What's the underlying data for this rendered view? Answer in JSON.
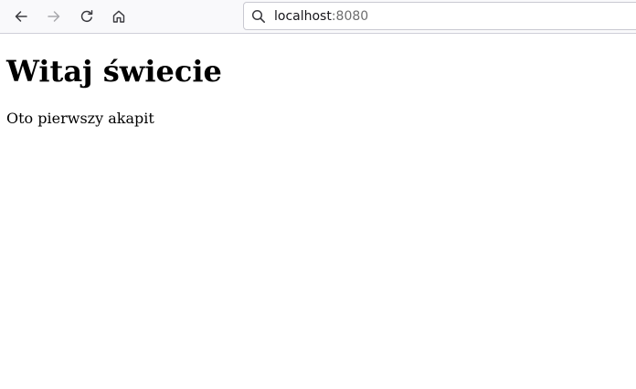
{
  "browser": {
    "toolbar": {
      "back_icon": "arrow-left",
      "forward_icon": "arrow-right",
      "reload_icon": "reload",
      "home_icon": "home"
    },
    "url": {
      "host": "localhost",
      "port": ":8080",
      "search_icon": "magnifier"
    }
  },
  "page": {
    "heading": "Witaj świecie",
    "paragraph": "Oto pierwszy akapit"
  }
}
